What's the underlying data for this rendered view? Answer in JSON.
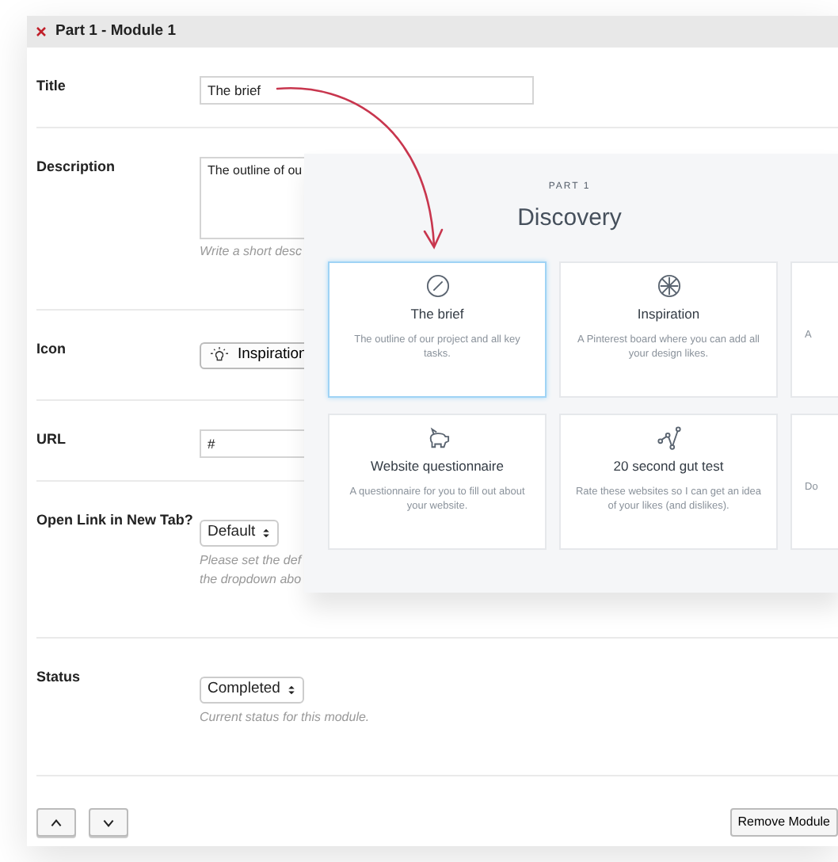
{
  "panel": {
    "title": "Part 1 - Module 1"
  },
  "fields": [
    {
      "kind": "text",
      "label": "Title",
      "value": "The brief"
    },
    {
      "kind": "textarea",
      "label": "Description",
      "value": "The outline of ou",
      "help": [
        "Write a short desc"
      ]
    },
    {
      "kind": "icon",
      "label": "Icon",
      "value": "Inspiration"
    },
    {
      "kind": "text",
      "label": "URL",
      "value": "#"
    },
    {
      "kind": "select",
      "label": "Open Link in New Tab?",
      "value": "Default",
      "help": [
        "Please set the def",
        "the dropdown abo"
      ]
    },
    {
      "kind": "select",
      "label": "Status",
      "value": "Completed",
      "help": [
        "Current status for this module."
      ]
    }
  ],
  "footer": {
    "remove_button": "Remove Module"
  },
  "preview": {
    "eyebrow": "PART 1",
    "title": "Discovery",
    "cards": [
      {
        "title": "The brief",
        "description": "The outline of our project and all key tasks.",
        "selected": true
      },
      {
        "title": "Inspiration",
        "description": "A Pinterest board where you can add all your design likes.",
        "selected": false
      },
      {
        "description": "A",
        "selected": false
      },
      {
        "title": "Website questionnaire",
        "description": "A questionnaire for you to fill out about your website.",
        "selected": false
      },
      {
        "title": "20 second gut test",
        "description": "Rate these websites so I can get an idea of your likes (and dislikes).",
        "selected": false
      },
      {
        "description": "Do",
        "selected": false
      }
    ]
  }
}
